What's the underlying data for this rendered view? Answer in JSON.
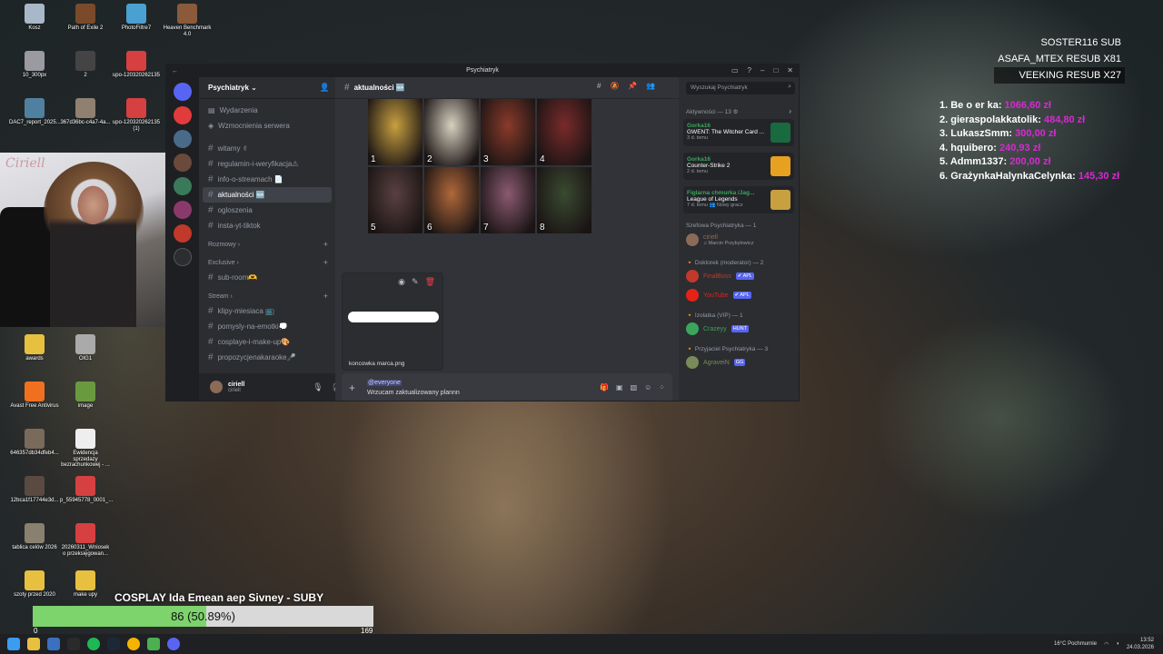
{
  "desktop_icons": [
    {
      "label": "Kosz",
      "color": "#a8b8c8"
    },
    {
      "label": "Path of Exile 2",
      "color": "#7a4a2a"
    },
    {
      "label": "PhotoFiltre7",
      "color": "#4aa0d0"
    },
    {
      "label": "Heaven Benchmark 4.0",
      "color": "#8a5a3a"
    },
    {
      "label": "10_300px",
      "color": "#9a9aa0"
    },
    {
      "label": "2",
      "color": "#444"
    },
    {
      "label": "upo-120320262135",
      "color": "#d64040"
    },
    {
      "label": "DAC7_report_2025...",
      "color": "#5080a0"
    },
    {
      "label": "367d36bc-c4a7-4a...",
      "color": "#908070"
    },
    {
      "label": "upo-120320262135 (1)",
      "color": "#d64040"
    },
    {
      "label": "awards",
      "color": "#e8c040"
    },
    {
      "label": "OIG1",
      "color": "#aaa"
    },
    {
      "label": "Avast Free Antivirus",
      "color": "#f07020"
    },
    {
      "label": "image",
      "color": "#6a9a40"
    },
    {
      "label": "646357db34dfeb4...",
      "color": "#7a6a5a"
    },
    {
      "label": "Ewidencja sprzedazy bezrachunkowej - ...",
      "color": "#eee"
    },
    {
      "label": "12bca1f17744e3d...",
      "color": "#5a4a40"
    },
    {
      "label": "p_55945778_0001_...",
      "color": "#d64040"
    },
    {
      "label": "tablica celów 2026",
      "color": "#8a8070"
    },
    {
      "label": "20260311_Wniosek o przeksięgowan...",
      "color": "#d64040"
    },
    {
      "label": "szoty przed 2020",
      "color": "#e8c040"
    },
    {
      "label": "make upy",
      "color": "#e8c040"
    }
  ],
  "webcam": {
    "logo": "Ciriell"
  },
  "overlay": {
    "subs": [
      "SOSTER116  SUB",
      "ASAFA_MTEX  RESUB X81",
      "VEEKING  RESUB X27"
    ],
    "donors": [
      {
        "name": "1. Be o er ka:",
        "amount": "1066,60 zł"
      },
      {
        "name": "2. gieraspolakkatolik:",
        "amount": "484,80 zł"
      },
      {
        "name": "3. LukaszSmm:",
        "amount": "300,00 zł"
      },
      {
        "name": "4. hquibero:",
        "amount": "240,93 zł"
      },
      {
        "name": "5. Admm1337:",
        "amount": "200,00 zł"
      },
      {
        "name": "6. GrażynkaHalynkaCelynka:",
        "amount": "145,30 zł"
      }
    ],
    "goal": {
      "title": "COSPLAY Ida Emean aep Sivney - SUBY",
      "text": "86 (50.89%)",
      "fraction": 0.5089,
      "min": "0",
      "max": "169"
    }
  },
  "discord": {
    "window_title": "Psychiatryk",
    "server_name": "Psychiatryk",
    "top_items": [
      "Wydarzenia",
      "Wzmocnienia serwera"
    ],
    "channels": [
      {
        "name": "witamy ✌",
        "active": false
      },
      {
        "name": "regulamin-i-weryfikacja⚠",
        "active": false
      },
      {
        "name": "info-o-streamach 📄",
        "active": false
      },
      {
        "name": "aktualności 🆕",
        "active": true
      },
      {
        "name": "ogloszenia",
        "active": false
      },
      {
        "name": "insta-yt-tiktok",
        "active": false
      }
    ],
    "categories": [
      {
        "name": "Rozmowy",
        "channels": []
      },
      {
        "name": "Exclusive",
        "channels": [
          "sub-room🫶"
        ]
      },
      {
        "name": "Stream",
        "channels": [
          "klipy-miesiaca 📺",
          "pomysly-na-emotki💭",
          "cosplaye-i-make-up🎨",
          "propozycjenakaraoke🎤"
        ]
      }
    ],
    "user": {
      "name": "ciriell",
      "tag": "ciriell"
    },
    "channel_header": "aktualności 🆕",
    "gallery_labels": [
      "1",
      "2",
      "3",
      "4",
      "5",
      "6",
      "7",
      "8"
    ],
    "attachment": {
      "filename": "koncowka marca.png"
    },
    "composer": {
      "mention": "@everyone",
      "message": "Wrzucam zaktualizowany plannn"
    },
    "search_placeholder": "Wyszukaj Psychiatryk",
    "activity": {
      "heading": "Aktywności — 13 ⚙",
      "cards": [
        {
          "user": "Gorka16",
          "game": "GWENT: The Witcher Card ...",
          "time": "3 d. temu",
          "color": "#1a6a40"
        },
        {
          "user": "Gorka16",
          "game": "Counter-Strike 2",
          "time": "2 d. temu",
          "color": "#e8a020"
        },
        {
          "user": "Figlarna chmurka /Jag...",
          "game": "League of Legends",
          "time": "7 d. temu  👥 Nowy gracz",
          "color": "#c8a040"
        }
      ]
    },
    "member_sections": [
      {
        "heading": "Szefowa Psychiatryka — 1",
        "members": [
          {
            "name": "ciriell",
            "sub": "♫ Marcin Przybyłowicz",
            "color": "#8a6b57",
            "badge": ""
          }
        ]
      },
      {
        "heading": "🔸 Doktorek (moderator) — 2",
        "members": [
          {
            "name": "FinalBoss",
            "sub": "",
            "color": "#c0392b",
            "badge": "✔ APL"
          },
          {
            "name": "YouTube",
            "sub": "",
            "color": "#e62117",
            "badge": "✔ APL"
          }
        ]
      },
      {
        "heading": "🔸 Izolatka (VIP) — 1",
        "members": [
          {
            "name": "Crazeyy",
            "sub": "",
            "color": "#3ba55c",
            "badge": "HUNT"
          }
        ]
      },
      {
        "heading": "🔸 Przyjaciel Psychiatryka — 3",
        "members": [
          {
            "name": "AgraveiN",
            "sub": "",
            "color": "#7a8a5a",
            "badge": "GG"
          }
        ]
      }
    ]
  },
  "taskbar": {
    "weather": "16°C Pochmurnie",
    "time": "13:52",
    "date": "24.03.2026"
  }
}
